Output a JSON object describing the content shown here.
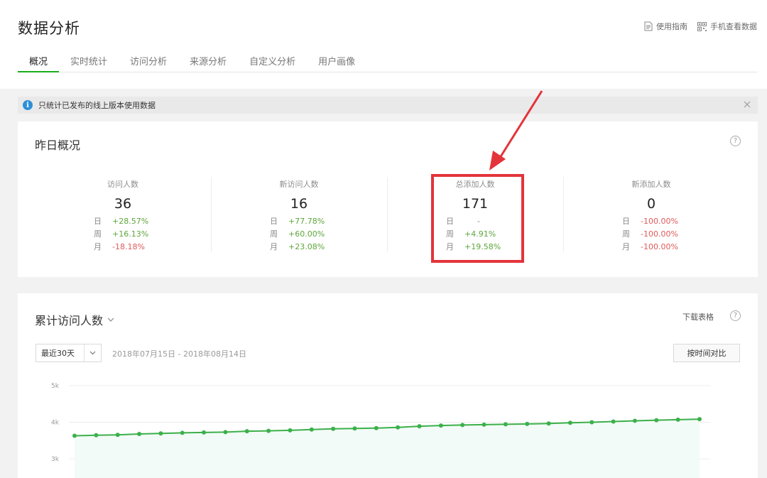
{
  "page": {
    "title": "数据分析",
    "links": {
      "guide": "使用指南",
      "mobile": "手机查看数据"
    }
  },
  "tabs": [
    "概况",
    "实时统计",
    "访问分析",
    "来源分析",
    "自定义分析",
    "用户画像"
  ],
  "notice": {
    "text": "只统计已发布的线上版本使用数据"
  },
  "overview": {
    "title": "昨日概况",
    "help": "?",
    "stats": [
      {
        "label": "访问人数",
        "value": "36",
        "rows": [
          {
            "k": "日",
            "v": "+28.57%",
            "trend": "up"
          },
          {
            "k": "周",
            "v": "+16.13%",
            "trend": "up"
          },
          {
            "k": "月",
            "v": "-18.18%",
            "trend": "down"
          }
        ]
      },
      {
        "label": "新访问人数",
        "value": "16",
        "rows": [
          {
            "k": "日",
            "v": "+77.78%",
            "trend": "up"
          },
          {
            "k": "周",
            "v": "+60.00%",
            "trend": "up"
          },
          {
            "k": "月",
            "v": "+23.08%",
            "trend": "up"
          }
        ]
      },
      {
        "label": "总添加人数",
        "value": "171",
        "rows": [
          {
            "k": "日",
            "v": "-",
            "trend": "neutral"
          },
          {
            "k": "周",
            "v": "+4.91%",
            "trend": "up"
          },
          {
            "k": "月",
            "v": "+19.58%",
            "trend": "up"
          }
        ]
      },
      {
        "label": "新添加人数",
        "value": "0",
        "rows": [
          {
            "k": "日",
            "v": "-100.00%",
            "trend": "down"
          },
          {
            "k": "周",
            "v": "-100.00%",
            "trend": "down"
          },
          {
            "k": "月",
            "v": "-100.00%",
            "trend": "down"
          }
        ]
      }
    ]
  },
  "trend": {
    "title": "累计访问人数",
    "download": "下载表格",
    "help": "?",
    "range": "最近30天",
    "date_range": "2018年07月15日 - 2018年08月14日",
    "compare": "按时间对比"
  },
  "colors": {
    "accent": "#1aad19",
    "line": "#3cb04a",
    "up": "#5fa63c",
    "down": "#e05a5a",
    "highlight": "#e3343a"
  },
  "chart_data": {
    "type": "line",
    "y_ticks": [
      "5k",
      "4k",
      "3k"
    ],
    "ylim": [
      3000,
      5000
    ],
    "series": [
      {
        "values": [
          3630,
          3645,
          3655,
          3680,
          3695,
          3710,
          3720,
          3730,
          3755,
          3765,
          3780,
          3800,
          3820,
          3830,
          3840,
          3860,
          3890,
          3910,
          3925,
          3935,
          3945,
          3955,
          3965,
          3985,
          4000,
          4020,
          4040,
          4055,
          4070,
          4085
        ]
      }
    ],
    "grid": true
  }
}
